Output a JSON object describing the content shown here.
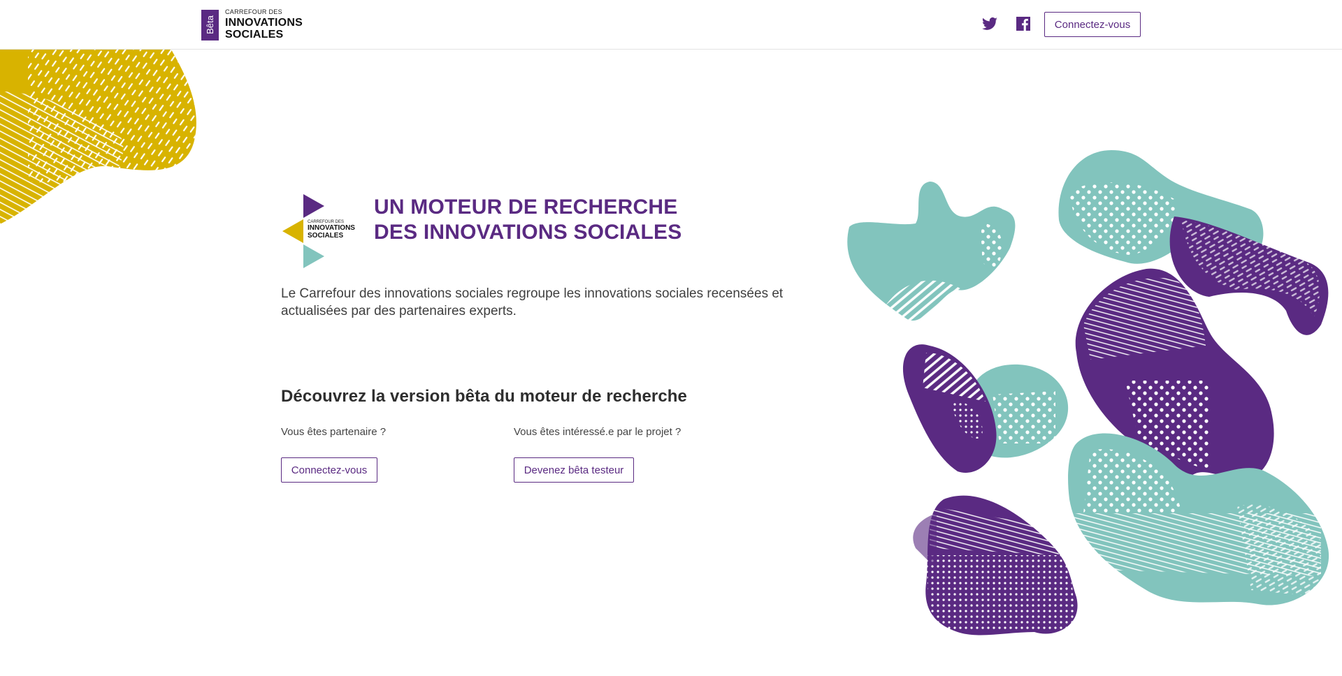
{
  "header": {
    "beta_label": "Bêta",
    "brand_small": "CARREFOUR DES",
    "brand_line1": "INNOVATIONS",
    "brand_line2": "SOCIALES",
    "login_label": "Connectez-vous"
  },
  "hero": {
    "logo_small": "CARREFOUR DES",
    "logo_line1": "INNOVATIONS",
    "logo_line2": "SOCIALES",
    "title_line1": "UN MOTEUR DE RECHERCHE",
    "title_line2": "DES INNOVATIONS SOCIALES",
    "intro": "Le Carrefour des innovations sociales regroupe les innovations sociales recensées et actualisées par des partenaires experts.",
    "discover_heading": "Découvrez la version bêta du moteur de recherche"
  },
  "partner": {
    "question": "Vous êtes partenaire ?",
    "button": "Connectez-vous"
  },
  "interested": {
    "question": "Vous êtes intéressé.e par le projet ?",
    "button": "Devenez bêta testeur"
  },
  "icons": {
    "twitter": "twitter-icon",
    "facebook": "facebook-icon"
  },
  "colors": {
    "purple": "#5a2a82",
    "yellow": "#d8b300",
    "teal": "#82c4bd"
  }
}
